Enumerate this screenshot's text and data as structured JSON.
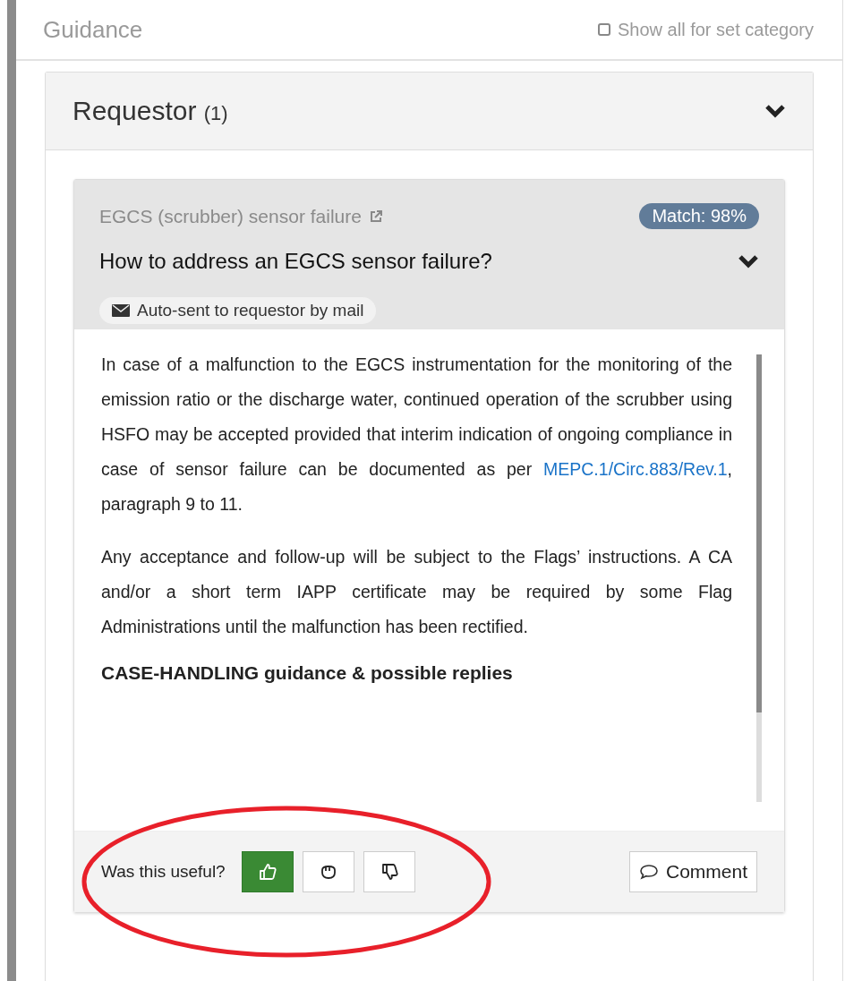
{
  "panel": {
    "title": "Guidance",
    "show_all": {
      "label": "Show all for set category",
      "checked": false
    }
  },
  "section": {
    "title": "Requestor",
    "count": "(1)",
    "expanded": true
  },
  "card": {
    "category": "EGCS (scrubber) sensor failure",
    "match": "Match: 98%",
    "question": "How to address an EGCS sensor failure?",
    "expanded": true,
    "sent_badge": "Auto-sent to requestor by mail",
    "paragraphs": [
      {
        "text": "In case of a malfunction to the EGCS instrumentation for the monitoring of the emission ratio or the discharge water, continued operation of the scrubber using HSFO may be accepted provided that interim indication of ongoing compliance in case of sensor failure can be documented as per",
        "link": "MEPC.1/Circ.883/Rev.1",
        "after": ", paragraph 9 to 11."
      },
      {
        "text": "Any acceptance and follow-up will be subject to the Flags’ instructions. A CA and/or a short term IAPP certificate may be required by some Flag Administrations until the malfunction has been rectified."
      }
    ],
    "subheading": "CASE-HANDLING guidance & possible replies"
  },
  "feedback": {
    "prompt": "Was this useful?",
    "options": [
      {
        "kind": "up",
        "selected": true
      },
      {
        "kind": "neutral",
        "selected": false
      },
      {
        "kind": "down",
        "selected": false
      }
    ],
    "comment_button": "Comment"
  }
}
